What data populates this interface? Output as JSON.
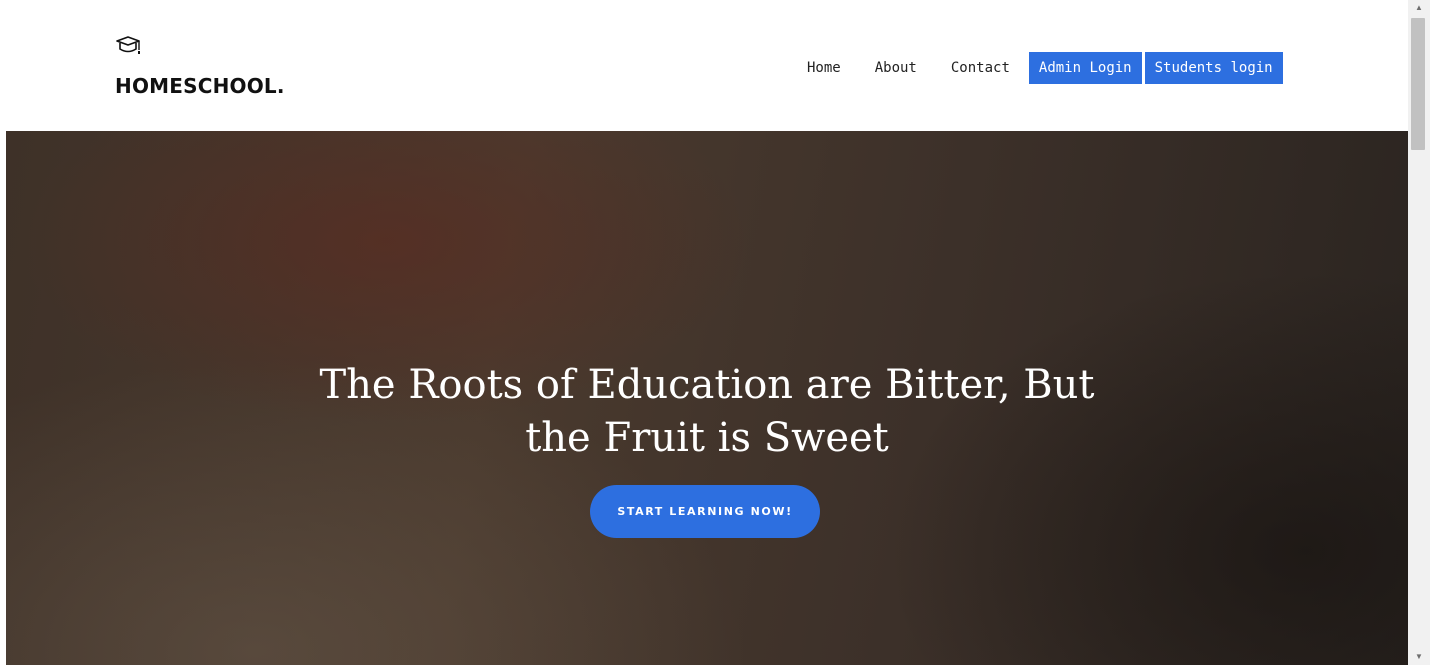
{
  "brand": {
    "name": "HOMESCHOOL.",
    "icon": "graduation-cap-icon"
  },
  "nav": {
    "links": [
      "Home",
      "About",
      "Contact"
    ],
    "buttons": [
      "Admin Login",
      "Students login"
    ]
  },
  "hero": {
    "title_line1": "The Roots of Education are Bitter, But",
    "title_line2": "the Fruit is Sweet",
    "cta_label": "START LEARNING NOW!"
  },
  "colors": {
    "accent": "#2d6fe0",
    "hero_bg": "#3e3128"
  },
  "scrollbar": {
    "up_arrow": "▲",
    "down_arrow": "▼"
  }
}
